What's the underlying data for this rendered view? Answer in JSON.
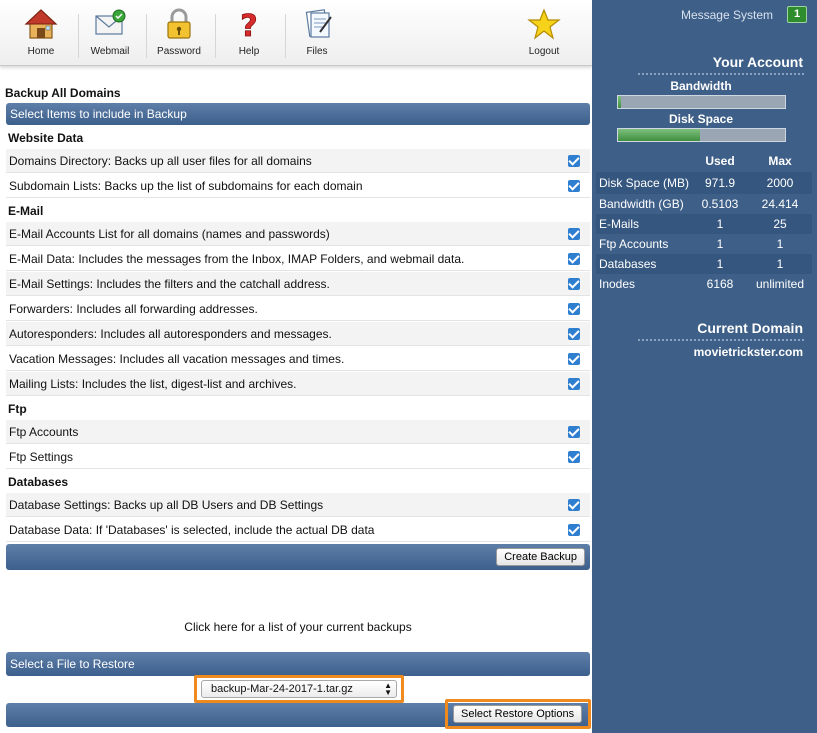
{
  "toolbar": {
    "items": [
      {
        "label": "Home",
        "icon": "home-icon"
      },
      {
        "label": "Webmail",
        "icon": "webmail-icon"
      },
      {
        "label": "Password",
        "icon": "padlock-icon"
      },
      {
        "label": "Help",
        "icon": "question-mark-icon"
      },
      {
        "label": "Files",
        "icon": "files-icon"
      },
      {
        "label": "Logout",
        "icon": "star-icon"
      }
    ]
  },
  "page_title": "Backup All Domains",
  "select_items_bar": "Select Items to include in Backup",
  "sections": {
    "website": {
      "title": "Website Data",
      "items": [
        "Domains Directory: Backs up all user files for all domains",
        "Subdomain Lists: Backs up the list of subdomains for each domain"
      ]
    },
    "email": {
      "title": "E-Mail",
      "items": [
        "E-Mail Accounts List for all domains (names and passwords)",
        "E-Mail Data: Includes the messages from the Inbox, IMAP Folders, and webmail data.",
        "E-Mail Settings: Includes the filters and the catchall address.",
        "Forwarders: Includes all forwarding addresses.",
        "Autoresponders: Includes all autoresponders and messages.",
        "Vacation Messages: Includes all vacation messages and times.",
        "Mailing Lists: Includes the list, digest-list and archives."
      ]
    },
    "ftp": {
      "title": "Ftp",
      "items": [
        "Ftp Accounts",
        "Ftp Settings"
      ]
    },
    "databases": {
      "title": "Databases",
      "items": [
        "Database Settings: Backs up all DB Users and DB Settings",
        "Database Data: If 'Databases' is selected, include the actual DB data"
      ]
    }
  },
  "create_backup_label": "Create Backup",
  "backups_link": "Click here for a list of your current backups",
  "restore_bar": "Select a File to Restore",
  "restore_file": "backup-Mar-24-2017-1.tar.gz",
  "restore_button_label": "Select Restore Options",
  "sidebar": {
    "message_system": "Message System",
    "message_count": "1",
    "your_account": "Your Account",
    "bandwidth_label": "Bandwidth",
    "bandwidth_fraction": 0.02,
    "disk_label": "Disk Space",
    "disk_fraction": 0.49,
    "col_used": "Used",
    "col_max": "Max",
    "usage": [
      {
        "name": "Disk Space (MB)",
        "used": "971.9",
        "max": "2000"
      },
      {
        "name": "Bandwidth (GB)",
        "used": "0.5103",
        "max": "24.414"
      },
      {
        "name": "E-Mails",
        "used": "1",
        "max": "25"
      },
      {
        "name": "Ftp Accounts",
        "used": "1",
        "max": "1"
      },
      {
        "name": "Databases",
        "used": "1",
        "max": "1"
      },
      {
        "name": "Inodes",
        "used": "6168",
        "max": "unlimited"
      }
    ],
    "current_domain": "Current Domain",
    "domain_name": "movietrickster.com"
  },
  "colors": {
    "sidebar_bg": "#3e5f88",
    "bar_bg": "#3c5f8c",
    "highlight": "#ee8a1e",
    "checkbox": "#2f7fd0"
  }
}
